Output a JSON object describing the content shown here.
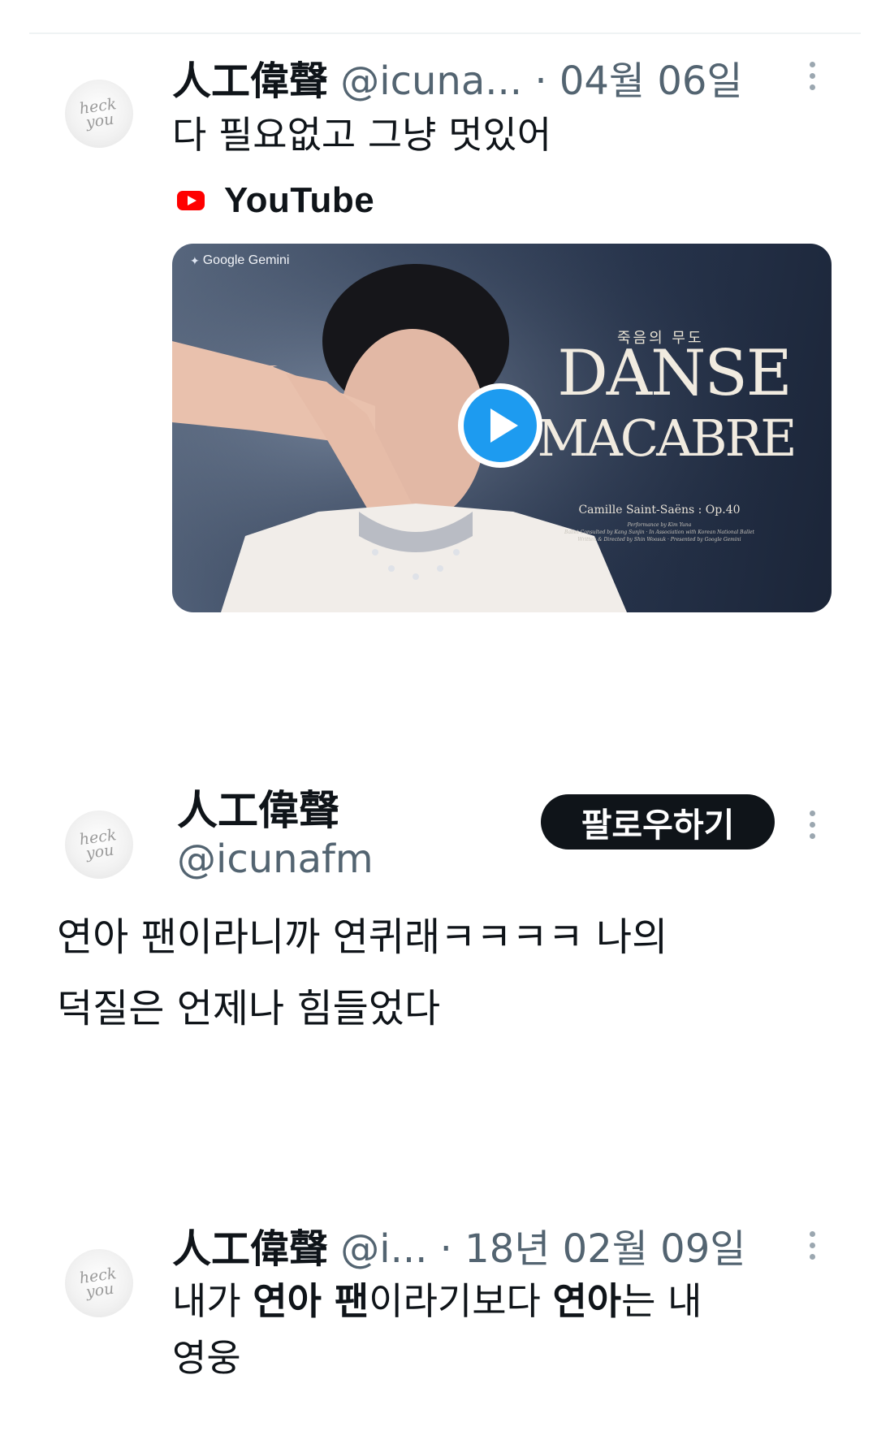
{
  "tweet1": {
    "name": "人工偉聲",
    "handle": "@icuna...",
    "date": "· 04월 06일",
    "text": "다 필요없고 그냥 멋있어",
    "link_source": "YouTube",
    "video": {
      "badge": "Google Gemini",
      "title_kr": "죽음의 무도",
      "title_line1": "DANSE",
      "title_line2": "MACABRE",
      "composer": "Camille Saint-Saëns : Op.40",
      "credits": [
        "Performance by Kim Yuna",
        "Ballet Consulted by Kang Sunjin · In Association with Korean National Ballet",
        "Written & Directed by Shin Woosuk · Presented by Google Gemini"
      ]
    }
  },
  "tweet2": {
    "name": "人工偉聲",
    "handle": "@icunafm",
    "follow_label": "팔로우하기",
    "text_line1": "연아 팬이라니까 연퀴래ㅋㅋㅋㅋ 나의",
    "text_line2": "덕질은 언제나 힘들었다"
  },
  "tweet3": {
    "name": "人工偉聲",
    "handle": "@i...",
    "date": "· 18년 02월 09일",
    "text_part1": "내가 ",
    "text_bold1": "연아 팬",
    "text_part2": "이라기보다 ",
    "text_bold2": "연아",
    "text_part3": "는 내",
    "text_line2": "영웅"
  },
  "avatar_lettering": "heck\nyou",
  "icons": {
    "more": "more-vertical-icon",
    "youtube": "youtube-logo-icon",
    "play": "play-icon",
    "gemini": "gemini-star-icon"
  },
  "colors": {
    "text": "#0f1419",
    "secondary": "#536471",
    "follow_bg": "#0f1419",
    "play_blue": "#1d9bf0",
    "youtube_red": "#ff0000"
  }
}
